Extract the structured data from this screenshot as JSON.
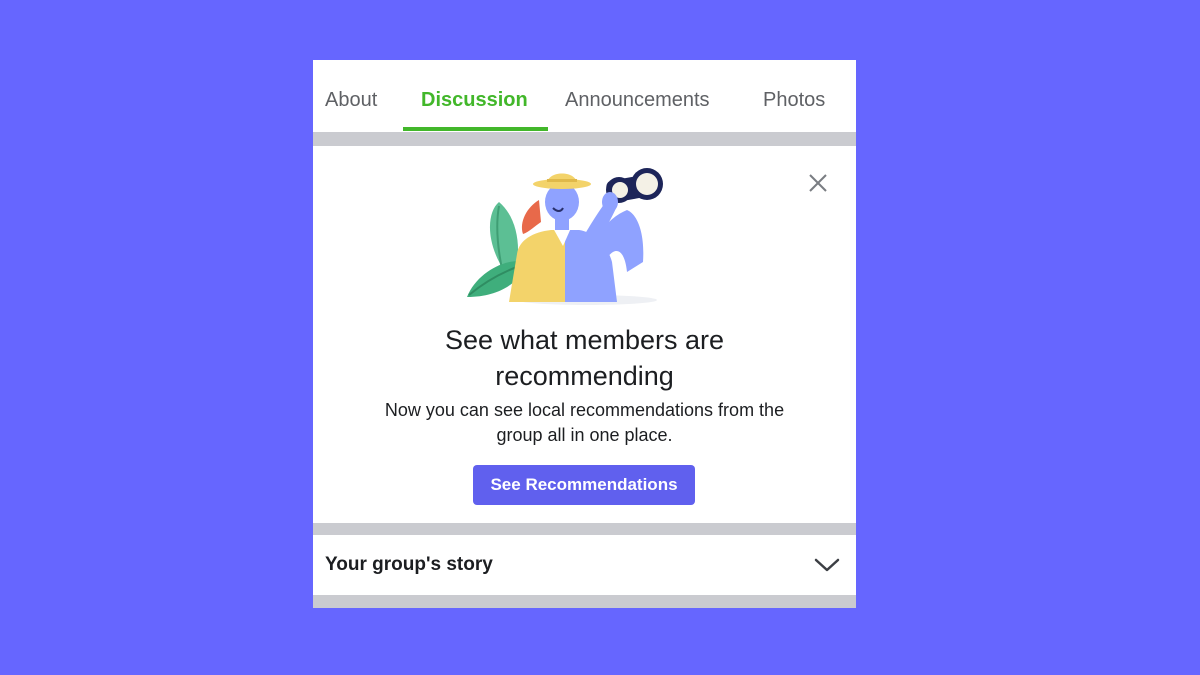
{
  "tabs": [
    {
      "label": "About",
      "active": false
    },
    {
      "label": "Discussion",
      "active": true
    },
    {
      "label": "Announcements",
      "active": false
    },
    {
      "label": "Photos",
      "active": false
    }
  ],
  "promo": {
    "title_line1": "See what members are",
    "title_line2": "recommending",
    "body_line1": "Now you can see local recommendations from the",
    "body_line2": "group all in one place.",
    "button_label": "See Recommendations",
    "close_icon": "close-icon",
    "illustration": "person-with-binoculars"
  },
  "story": {
    "label": "Your group's story",
    "icon": "chevron-down-icon"
  },
  "colors": {
    "background": "#6666ff",
    "active_tab": "#42b72a",
    "button": "#6060ee",
    "divider": "#cacbd0"
  }
}
